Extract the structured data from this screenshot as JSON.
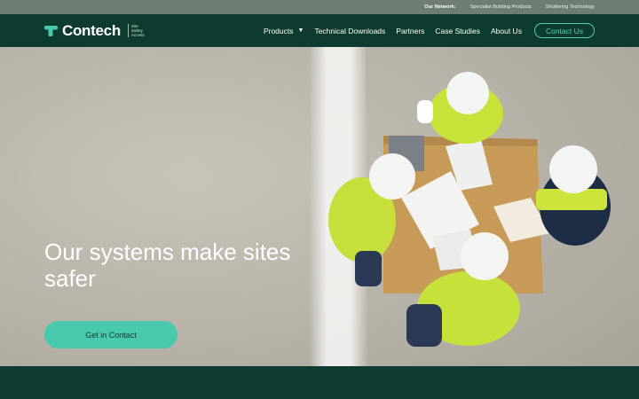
{
  "topbar": {
    "label": "Our Network:",
    "links": [
      "Specialist Building Products",
      "Shuttering Technology"
    ]
  },
  "brand": {
    "name": "Contech",
    "tagline": [
      "Site",
      "Safety",
      "Access"
    ],
    "mark_color": "#48c9ad"
  },
  "nav": {
    "items": [
      "Products",
      "Technical Downloads",
      "Partners",
      "Case Studies",
      "About Us"
    ],
    "contact": "Contact Us"
  },
  "hero": {
    "title": "Our systems make sites safer",
    "button": "Get in Contact"
  },
  "colors": {
    "dark_green": "#0d3b2f",
    "accent": "#48c9ad",
    "topbar": "#6e7c73"
  }
}
